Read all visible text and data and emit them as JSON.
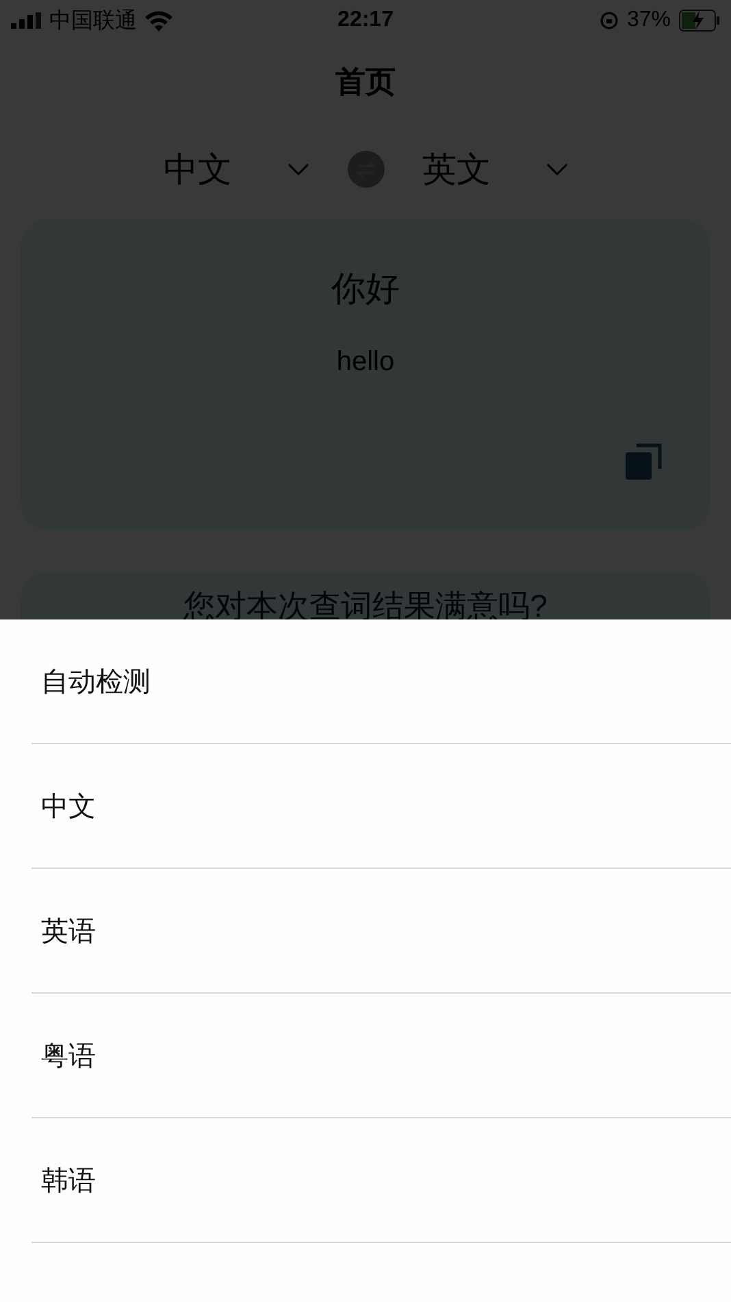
{
  "status_bar": {
    "carrier": "中国联通",
    "time": "22:17",
    "battery": "37%"
  },
  "header": {
    "title": "首页"
  },
  "languages": {
    "source": "中文",
    "target": "英文"
  },
  "result": {
    "source_text": "你好",
    "translation": "hello"
  },
  "feedback": {
    "question": "您对本次查词结果满意吗?"
  },
  "language_sheet": {
    "options": [
      {
        "label": "自动检测"
      },
      {
        "label": "中文"
      },
      {
        "label": "英语"
      },
      {
        "label": "粤语"
      },
      {
        "label": "韩语"
      }
    ]
  }
}
